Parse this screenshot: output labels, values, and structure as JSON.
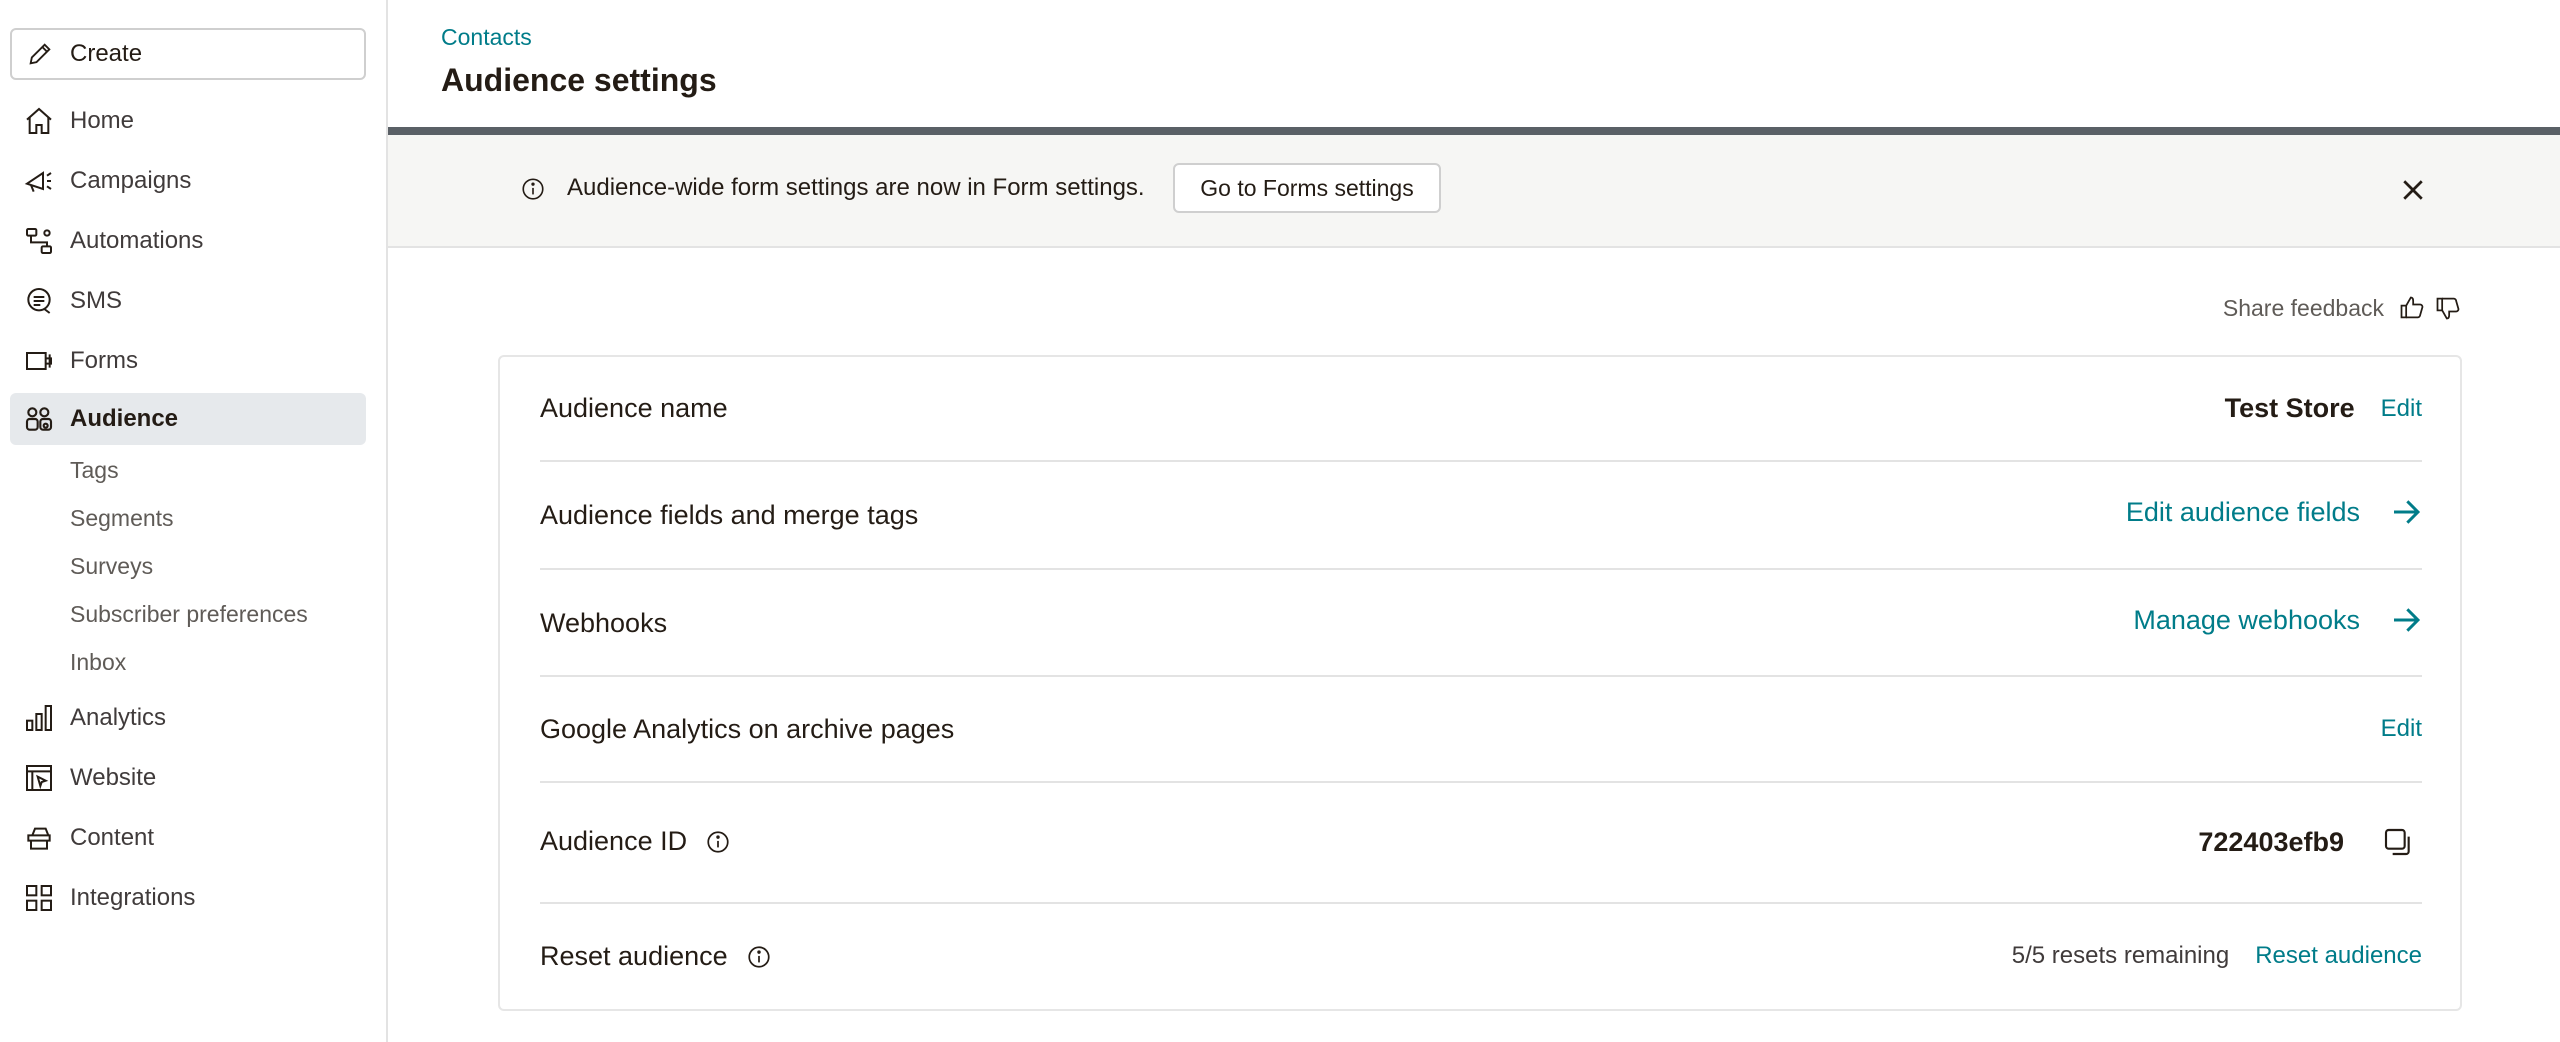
{
  "sidebar": {
    "create_label": "Create",
    "items": [
      {
        "label": "Home",
        "icon": "home-icon"
      },
      {
        "label": "Campaigns",
        "icon": "megaphone-icon"
      },
      {
        "label": "Automations",
        "icon": "automation-icon"
      },
      {
        "label": "SMS",
        "icon": "sms-icon"
      },
      {
        "label": "Forms",
        "icon": "form-icon"
      },
      {
        "label": "Audience",
        "icon": "audience-icon"
      },
      {
        "label": "Analytics",
        "icon": "bar-chart-icon"
      },
      {
        "label": "Website",
        "icon": "website-icon"
      },
      {
        "label": "Content",
        "icon": "content-icon"
      },
      {
        "label": "Integrations",
        "icon": "grid-icon"
      }
    ],
    "audience_sub": [
      "Tags",
      "Segments",
      "Surveys",
      "Subscriber preferences",
      "Inbox"
    ]
  },
  "header": {
    "breadcrumb": "Contacts",
    "title": "Audience settings"
  },
  "banner": {
    "text": "Audience-wide form settings are now in Form settings.",
    "button_label": "Go to Forms settings"
  },
  "feedback_label": "Share feedback",
  "settings": {
    "audience_name": {
      "label": "Audience name",
      "value": "Test Store",
      "action": "Edit"
    },
    "fields": {
      "label": "Audience fields and merge tags",
      "action": "Edit audience fields"
    },
    "webhooks": {
      "label": "Webhooks",
      "action": "Manage webhooks"
    },
    "analytics": {
      "label": "Google Analytics on archive pages",
      "action": "Edit"
    },
    "audience_id": {
      "label": "Audience ID",
      "value": "722403efb9"
    },
    "reset": {
      "label": "Reset audience",
      "status": "5/5 resets remaining",
      "action": "Reset audience"
    }
  },
  "colors": {
    "accent": "#007c89",
    "active_bg": "#e6e9ec",
    "rule": "#5a6066"
  }
}
